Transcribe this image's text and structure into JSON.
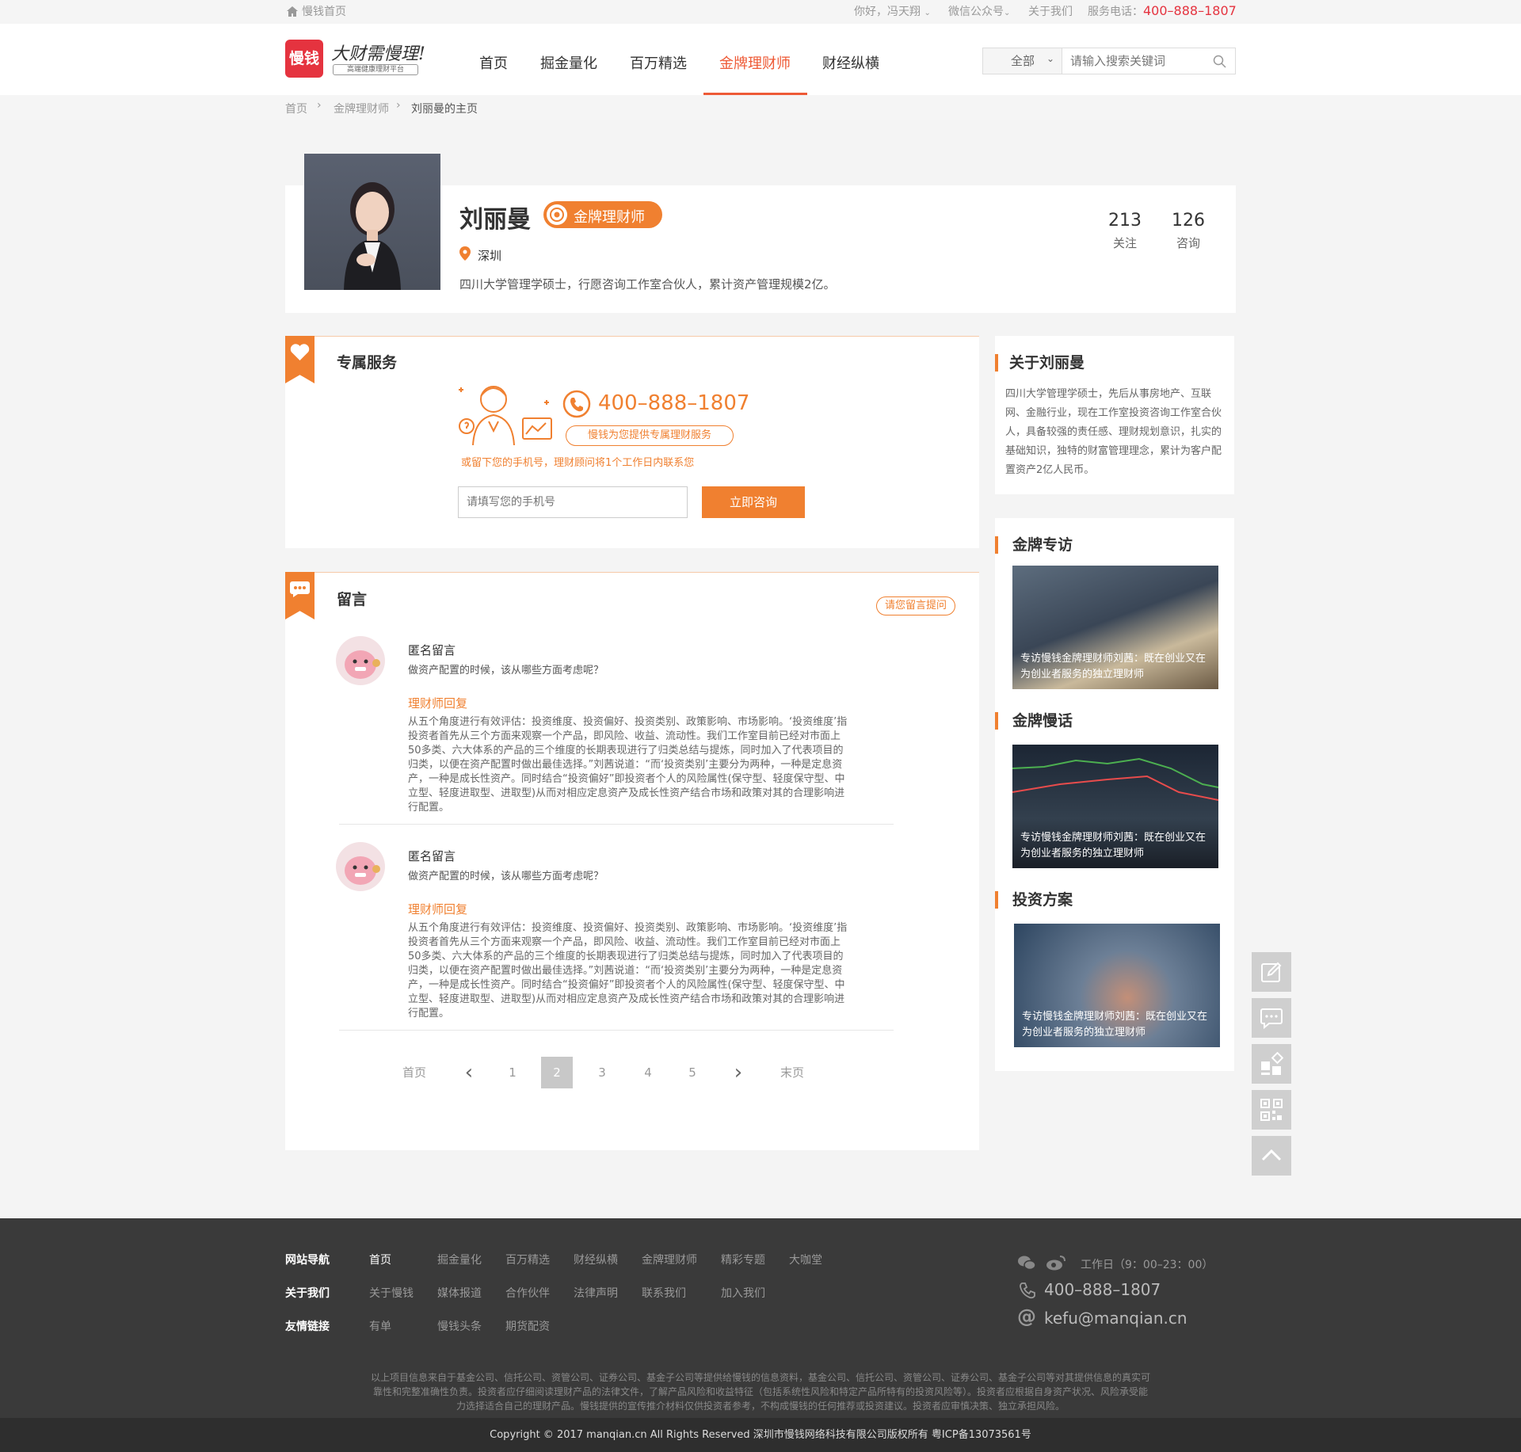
{
  "topbar": {
    "home_link": "慢钱首页",
    "greeting": "你好，冯天翔",
    "wechat": "微信公众号",
    "about": "关于我们",
    "service_label": "服务电话：",
    "service_phone": "400–888–1807"
  },
  "header": {
    "logo_text": "慢钱",
    "slogan": "大财需慢理!",
    "slogan_sub": "高端健康理财平台",
    "nav": [
      "首页",
      "掘金量化",
      "百万精选",
      "金牌理财师",
      "财经纵横"
    ],
    "active_nav": "金牌理财师",
    "search_scope": "全部",
    "search_placeholder": "请输入搜索关键词"
  },
  "breadcrumb": [
    "首页",
    "金牌理财师",
    "刘丽曼的主页"
  ],
  "profile": {
    "name": "刘丽曼",
    "badge": "金牌理财师",
    "city": "深圳",
    "intro": "四川大学管理学硕士，行愿咨询工作室合伙人，累计资产管理规模2亿。",
    "follow_count": "213",
    "follow_label": "关注",
    "consult_count": "126",
    "consult_label": "咨询"
  },
  "service": {
    "title": "专属服务",
    "phone": "400–888–1807",
    "pill": "慢钱为您提供专属理财服务",
    "hint": "或留下您的手机号，理财顾问将1个工作日内联系您",
    "input_placeholder": "请填写您的手机号",
    "button": "立即咨询"
  },
  "messages": {
    "title": "留言",
    "ask_button": "请您留言提问",
    "items": [
      {
        "author": "匿名留言",
        "question": "做资产配置的时候，该从哪些方面考虑呢？",
        "reply_label": "理财师回复",
        "reply": "从五个角度进行有效评估：投资维度、投资偏好、投资类别、政策影响、市场影响。‘投资维度’指投资者首先从三个方面来观察一个产品，即风险、收益、流动性。我们工作室目前已经对市面上50多类、六大体系的产品的三个维度的长期表现进行了归类总结与提炼，同时加入了代表项目的归类，以便在资产配置时做出最佳选择。”刘茜说道：“而‘投资类别’主要分为两种，一种是定息资产，一种是成长性资产。同时结合“投资偏好”即投资者个人的风险属性(保守型、轻度保守型、中立型、轻度进取型、进取型)从而对相应定息资产及成长性资产结合市场和政策对其的合理影响进行配置。"
      },
      {
        "author": "匿名留言",
        "question": "做资产配置的时候，该从哪些方面考虑呢？",
        "reply_label": "理财师回复",
        "reply": "从五个角度进行有效评估：投资维度、投资偏好、投资类别、政策影响、市场影响。‘投资维度’指投资者首先从三个方面来观察一个产品，即风险、收益、流动性。我们工作室目前已经对市面上50多类、六大体系的产品的三个维度的长期表现进行了归类总结与提炼，同时加入了代表项目的归类，以便在资产配置时做出最佳选择。”刘茜说道：“而‘投资类别’主要分为两种，一种是定息资产，一种是成长性资产。同时结合“投资偏好”即投资者个人的风险属性(保守型、轻度保守型、中立型、轻度进取型、进取型)从而对相应定息资产及成长性资产结合市场和政策对其的合理影响进行配置。"
      }
    ],
    "pagination": {
      "first": "首页",
      "pages": [
        "1",
        "2",
        "3",
        "4",
        "5"
      ],
      "current": "2",
      "last": "末页"
    }
  },
  "sidebar": {
    "about_title": "关于刘丽曼",
    "about_text": "四川大学管理学硕士，先后从事房地产、互联网、金融行业，现在工作室投资咨询工作室合伙人，具备较强的责任感、理财规划意识，扎实的基础知识，独特的财富管理理念，累计为客户配置资产2亿人民币。",
    "sections": [
      {
        "title": "金牌专访",
        "caption": "专访慢钱金牌理财师刘茜：既在创业又在为创业者服务的独立理财师"
      },
      {
        "title": "金牌慢话",
        "caption": "专访慢钱金牌理财师刘茜：既在创业又在为创业者服务的独立理财师"
      },
      {
        "title": "投资方案",
        "caption": "专访慢钱金牌理财师刘茜：既在创业又在为创业者服务的独立理财师"
      }
    ]
  },
  "tools": [
    "edit-icon",
    "chat-icon",
    "apps-icon",
    "qrcode-icon",
    "back-to-top-icon"
  ],
  "footer": {
    "rows": [
      {
        "label": "网站导航",
        "links": [
          "首页",
          "掘金量化",
          "百万精选",
          "财经纵横",
          "金牌理财师",
          "精彩专题",
          "大咖堂"
        ]
      },
      {
        "label": "关于我们",
        "links": [
          "关于慢钱",
          "媒体报道",
          "合作伙伴",
          "法律声明",
          "联系我们",
          "加入我们"
        ]
      },
      {
        "label": "友情链接",
        "links": [
          "有单",
          "慢钱头条",
          "期货配资"
        ]
      }
    ],
    "hours": "工作日（9：00–23：00）",
    "phone": "400–888–1807",
    "email": "kefu@manqian.cn",
    "disclaimer_1": "以上项目信息来自于基金公司、信托公司、资管公司、证券公司、基金子公司等提供给慢钱的信息资料，基金公司、信托公司、资管公司、证券公司、基金子公司等对其提供信息的真实可",
    "disclaimer_2": "靠性和完整准确性负责。投资者应仔细阅读理财产品的法律文件，了解产品风险和收益特征（包括系统性风险和特定产品所特有的投资风险等）。投资者应根据自身资产状况、风险承受能",
    "disclaimer_3": "力选择适合自己的理财产品。慢钱提供的宣传推介材料仅供投资者参考，不构成慢钱的任何推荐或投资建议。投资者应审慎决策、独立承担风险。",
    "copyright": "Copyright © 2017 manqian.cn All Rights Reserved 深圳市慢钱网络科技有限公司版权所有 粤ICP备13073561号"
  },
  "colors": {
    "accent": "#f08030",
    "brand_red": "#e5333f",
    "footer_bg": "#3a3a3a"
  }
}
